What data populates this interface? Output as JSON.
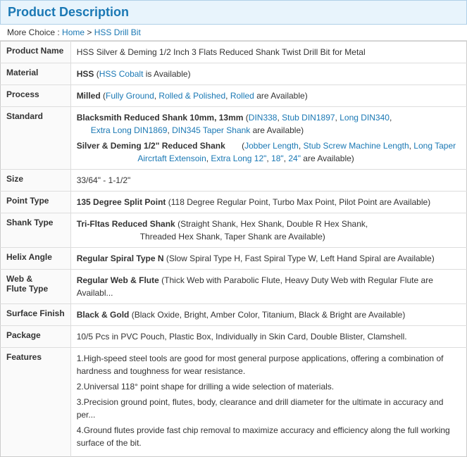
{
  "header": {
    "title": "Product Description"
  },
  "breadcrumb": {
    "prefix": "More Choice :",
    "home": "Home",
    "separator": ">",
    "category": "HSS Drill Bit"
  },
  "rows": [
    {
      "label": "Product Name",
      "value": "HSS Silver & Deming 1/2 Inch 3 Flats Reduced Shank Twist Drill Bit for Metal"
    },
    {
      "label": "Material",
      "value": "HSS",
      "extra": " (HSS Cobalt is Available)",
      "extra_link": "HSS Cobalt"
    },
    {
      "label": "Process",
      "value": "Milled",
      "extra": " (Fully Ground, Rolled & Polished, Rolled are Available)",
      "links": [
        "Fully Ground",
        "Rolled & Polished",
        "Rolled"
      ]
    },
    {
      "label": "Standard",
      "value_lines": [
        {
          "bold": "Blacksmith Reduced Shank 10mm, 13mm",
          "rest": " (DIN338, Stub DIN1897, Long DIN340, Extra Long DIN1869, DIN345 Taper Shank are Available)",
          "links": [
            "DIN338",
            "Stub DIN1897",
            "Long DIN340",
            "Extra Long DIN1869",
            "DIN345 Taper Shank"
          ]
        },
        {
          "bold": "Silver & Deming 1/2\" Reduced Shank",
          "rest": "       (Jobber Length, Stub Screw Machine Length, Long Taper Aircrtaft Extensoin, Extra Long 12\", 18\", 24\" are Available)",
          "links": [
            "Jobber Length",
            "Stub Screw Machine Length",
            "Long Taper Aircrtaft Extensoin",
            "Extra Long 12\"",
            "18\"",
            "24\""
          ]
        }
      ]
    },
    {
      "label": "Size",
      "value": "33/64\" - 1-1/2\""
    },
    {
      "label": "Point Type",
      "value": "135 Degree Split Point",
      "extra": "  (118 Degree Regular Point, Turbo Max Point, Pilot Point are Available)"
    },
    {
      "label": "Shank Type",
      "value": "Tri-Fltas Reduced Shank",
      "extra": "   (Straight Shank, Hex Shank, Double R Hex Shank, Threaded Hex Shank, Taper Shank are Available)"
    },
    {
      "label": "Helix Angle",
      "value": "Regular Spiral Type N",
      "extra": "  (Slow Spiral Type H, Fast Spiral Type W, Left Hand Spiral are Available)"
    },
    {
      "label": "Web & Flute Type",
      "value": "Regular Web & Flute",
      "extra": "  (Thick Web with Parabolic Flute, Heavy Duty Web with Regular Flute are Availabl..."
    },
    {
      "label": "Surface Finish",
      "value": "Black & Gold",
      "extra": "  (Black Oxide, Bright, Amber Color, Titanium, Black & Bright are Available)"
    },
    {
      "label": "Package",
      "value": "10/5 Pcs in PVC Pouch, Plastic Box, Individually in Skin Card, Double Blister, Clamshell."
    },
    {
      "label": "Features",
      "features": [
        "1.High-speed steel tools are good for most general purpose applications, offering a combination of hardness and toughness for wear resistance.",
        "2.Universal 118° point shape for drilling a wide selection of materials.",
        "3.Precision ground point, flutes, body, clearance and drill diameter for the ultimate in accuracy and per...",
        "4.Ground flutes provide fast chip removal to maximize accuracy and efficiency along the full working surface of the bit."
      ]
    }
  ]
}
